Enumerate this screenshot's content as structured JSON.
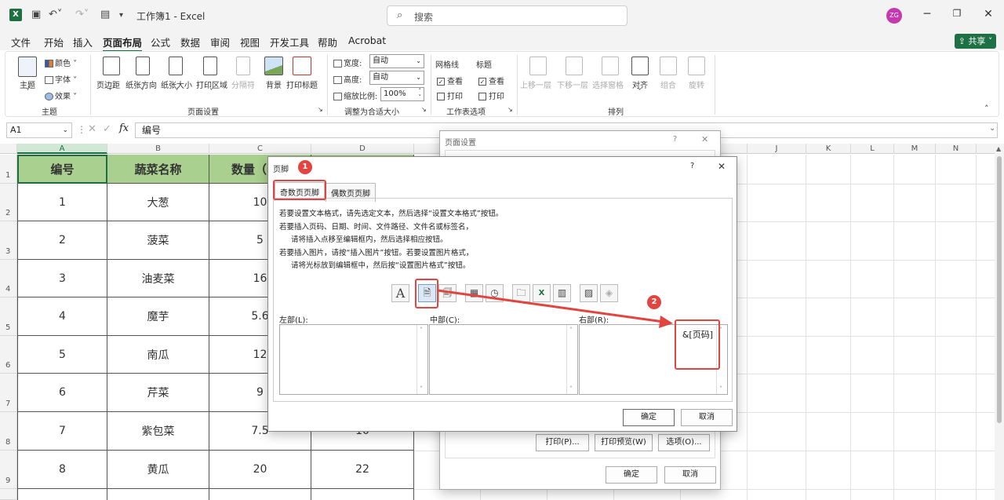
{
  "titlebar": {
    "app_icon": "X",
    "doc_title": "工作簿1 - Excel",
    "search_placeholder": "搜索",
    "avatar_initials": "ZG"
  },
  "menu": [
    "文件",
    "开始",
    "插入",
    "页面布局",
    "公式",
    "数据",
    "审阅",
    "视图",
    "开发工具",
    "帮助",
    "Acrobat"
  ],
  "share_label": "共享",
  "ribbon": {
    "theme": {
      "big": "主题",
      "colors": "颜色",
      "fonts": "字体",
      "effects": "效果",
      "group": "主题"
    },
    "page_setup": {
      "margins": "页边距",
      "orientation": "纸张方向",
      "size": "纸张大小",
      "print_area": "打印区域",
      "breaks": "分隔符",
      "background": "背景",
      "print_titles": "打印标题",
      "group": "页面设置"
    },
    "scale": {
      "width_label": "宽度:",
      "width_value": "自动",
      "height_label": "高度:",
      "height_value": "自动",
      "scale_label": "缩放比例:",
      "scale_value": "100%",
      "group": "调整为合适大小"
    },
    "sheet_options": {
      "gridlines": "网格线",
      "headings": "标题",
      "view": "查看",
      "print": "打印",
      "group": "工作表选项"
    },
    "arrange": {
      "bring_forward": "上移一层",
      "send_backward": "下移一层",
      "selection_pane": "选择窗格",
      "align": "对齐",
      "group_btn": "组合",
      "rotate": "旋转",
      "group": "排列"
    }
  },
  "formula_bar": {
    "cell_ref": "A1",
    "fx": "fx",
    "content": "编号"
  },
  "columns": [
    "A",
    "B",
    "C",
    "D",
    "E",
    "F",
    "G",
    "H",
    "I",
    "J",
    "K",
    "L",
    "M",
    "N"
  ],
  "table": {
    "headers": [
      "编号",
      "蔬菜名称",
      "数量（"
    ],
    "rows": [
      [
        "1",
        "大葱",
        "10",
        ""
      ],
      [
        "2",
        "菠菜",
        "5",
        ""
      ],
      [
        "3",
        "油麦菜",
        "16",
        ""
      ],
      [
        "4",
        "魔芋",
        "5.6",
        ""
      ],
      [
        "5",
        "南瓜",
        "12",
        ""
      ],
      [
        "6",
        "芹菜",
        "9",
        ""
      ],
      [
        "7",
        "紫包菜",
        "7.5",
        "10"
      ],
      [
        "8",
        "黄瓜",
        "20",
        "22"
      ]
    ]
  },
  "row_numbers": [
    "1",
    "2",
    "3",
    "4",
    "5",
    "6",
    "7",
    "8",
    "9"
  ],
  "page_setup_dialog": {
    "title": "页面设置",
    "help": "?",
    "close": "✕",
    "print_btn": "打印(P)...",
    "preview_btn": "打印预览(W)",
    "options_btn": "选项(O)...",
    "ok": "确定",
    "cancel": "取消"
  },
  "footer_dialog": {
    "title": "页脚",
    "help": "?",
    "close": "✕",
    "tabs": [
      "奇数页页脚",
      "偶数页页脚"
    ],
    "instructions": [
      "若要设置文本格式，请先选定文本，然后选择“设置文本格式”按钮。",
      "若要插入页码、日期、时间、文件路径、文件名或标签名，",
      "请将插入点移至编辑框内，然后选择相应按钮。",
      "若要插入图片，请按“插入图片”按钮。若要设置图片格式，",
      "请将光标放到编辑框中，然后按“设置图片格式”按钮。"
    ],
    "left_label": "左部(L):",
    "center_label": "中部(C):",
    "right_label": "右部(R):",
    "right_content": "&[页码]",
    "ok": "确定",
    "cancel": "取消"
  },
  "annotations": {
    "badge1": "1",
    "badge2": "2"
  }
}
